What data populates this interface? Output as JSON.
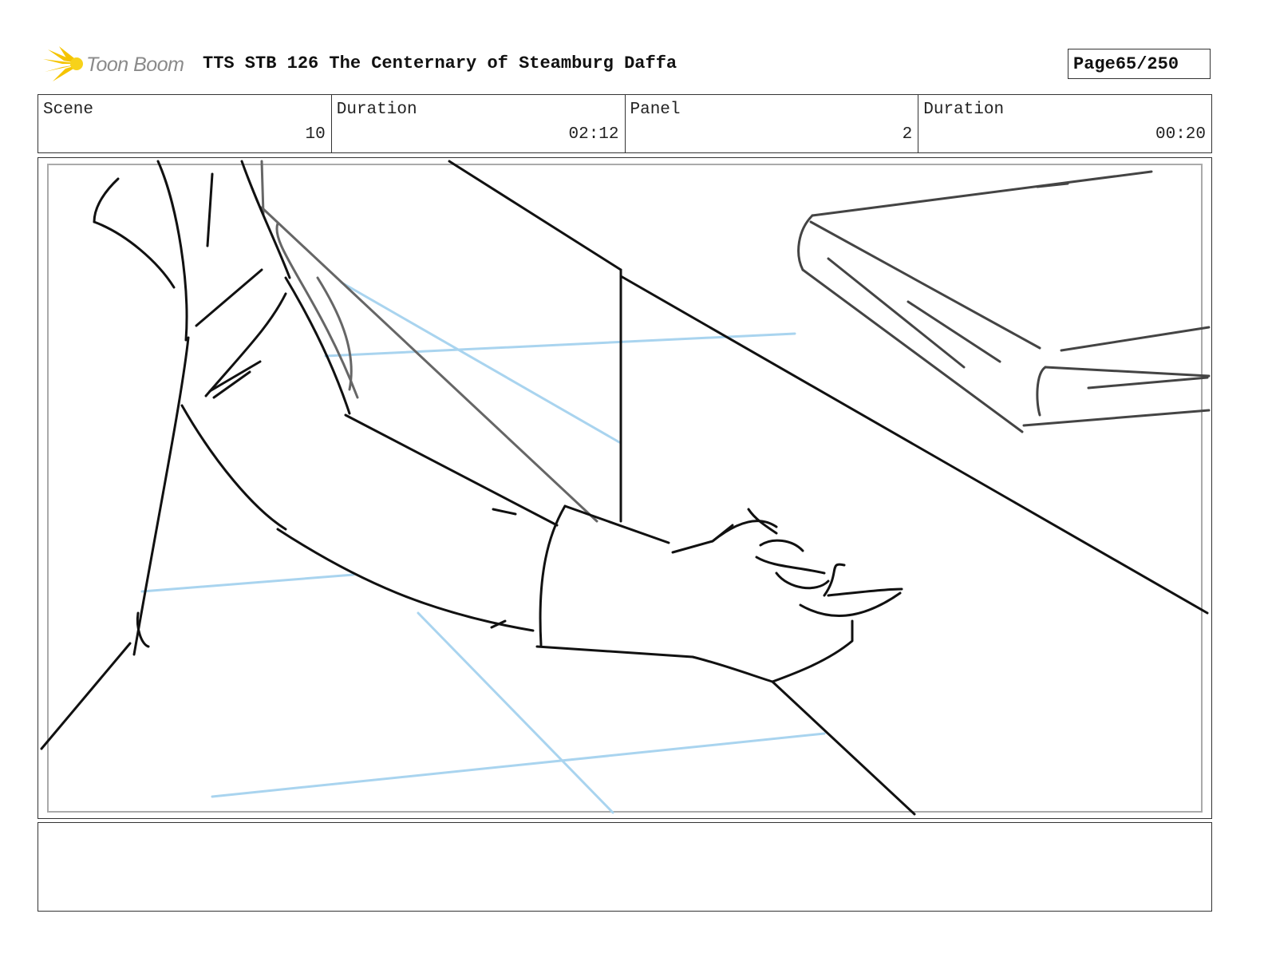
{
  "header": {
    "logo_text": "Toon Boom",
    "title": "TTS STB 126 The Centernary of Steamburg Daffa",
    "page_label": "Page",
    "page_value": "65/250"
  },
  "info": {
    "scene_label": "Scene",
    "scene_value": "10",
    "scene_duration_label": "Duration",
    "scene_duration_value": "02:12",
    "panel_label": "Panel",
    "panel_value": "2",
    "panel_duration_label": "Duration",
    "panel_duration_value": "00:20"
  },
  "notes": {
    "text": ""
  },
  "colors": {
    "logo_accent": "#f5c400",
    "sketch_line": "#111111",
    "construction_line": "#a9d4ef",
    "secondary_line": "#666666"
  }
}
